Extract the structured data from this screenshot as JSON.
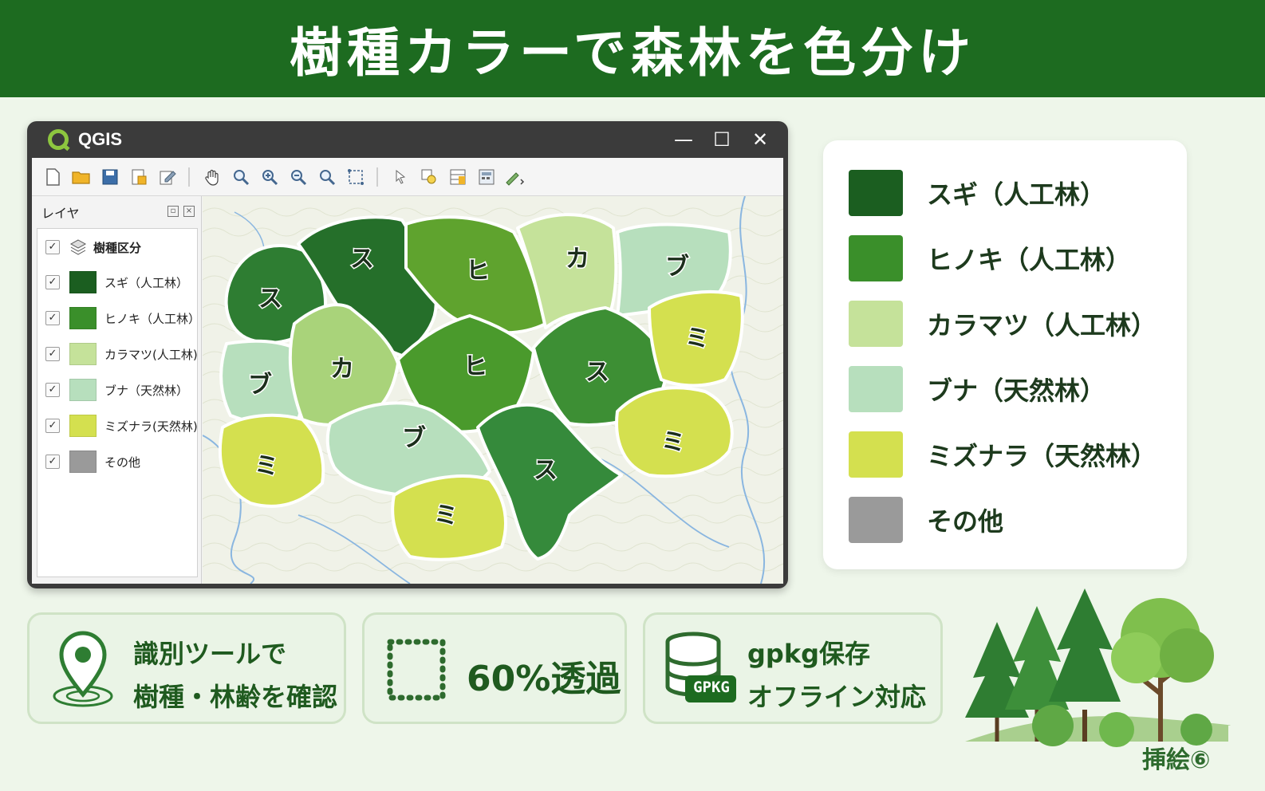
{
  "banner": {
    "title": "樹種カラーで森林を色分け"
  },
  "window": {
    "title": "QGIS",
    "controls": {
      "minimize": "—",
      "maximize": "☐",
      "close": "✕"
    }
  },
  "layers_panel": {
    "title": "レイヤ",
    "group": "樹種区分",
    "items": [
      {
        "label": "スギ（人工林）",
        "color": "#1b5e20"
      },
      {
        "label": "ヒノキ（人工林）",
        "color": "#3a8f2a"
      },
      {
        "label": "カラマツ(人工林)",
        "color": "#c5e29a"
      },
      {
        "label": "ブナ（天然林）",
        "color": "#b7dfbd"
      },
      {
        "label": "ミズナラ(天然林)",
        "color": "#d4e04f"
      },
      {
        "label": "その他",
        "color": "#9a9a9a"
      }
    ]
  },
  "map": {
    "regions": [
      {
        "label": "ス",
        "color": "#2e7d32"
      },
      {
        "label": "ス",
        "color": "#256f2a"
      },
      {
        "label": "ヒ",
        "color": "#5fa32e"
      },
      {
        "label": "カ",
        "color": "#c5e29a"
      },
      {
        "label": "ブ",
        "color": "#b7dfbd"
      },
      {
        "label": "ブ",
        "color": "#b7dfbd"
      },
      {
        "label": "カ",
        "color": "#a9d37a"
      },
      {
        "label": "ヒ",
        "color": "#4a9a2c"
      },
      {
        "label": "ス",
        "color": "#3d8f34"
      },
      {
        "label": "ミ",
        "color": "#d4e04f"
      },
      {
        "label": "ミ",
        "color": "#d4e04f"
      },
      {
        "label": "ブ",
        "color": "#b7dfbd"
      },
      {
        "label": "ス",
        "color": "#358a3b"
      },
      {
        "label": "ミ",
        "color": "#d4e04f"
      },
      {
        "label": "ミ",
        "color": "#d4e04f"
      }
    ]
  },
  "legend": {
    "items": [
      {
        "label": "スギ（人工林）",
        "color": "#1b5e20"
      },
      {
        "label": "ヒノキ（人工林）",
        "color": "#3a8f2a"
      },
      {
        "label": "カラマツ（人工林）",
        "color": "#c5e29a"
      },
      {
        "label": "ブナ（天然林）",
        "color": "#b7dfbd"
      },
      {
        "label": "ミズナラ（天然林）",
        "color": "#d4e04f"
      },
      {
        "label": "その他",
        "color": "#9a9a9a"
      }
    ]
  },
  "features": {
    "identify": {
      "line1": "識別ツールで",
      "line2": "樹種・林齢を確認",
      "icon": "map-pin-icon"
    },
    "opacity": {
      "text": "60%透過",
      "icon": "dotted-square-icon"
    },
    "gpkg": {
      "line1": "gpkg保存",
      "line2": "オフライン対応",
      "badge": "GPKG",
      "icon": "database-icon"
    }
  },
  "caption": "挿絵⑥"
}
